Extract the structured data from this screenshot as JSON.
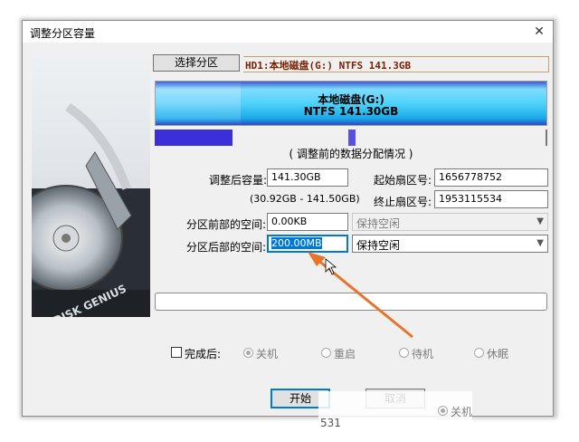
{
  "window": {
    "title": "调整分区容量",
    "close": "✕"
  },
  "sidebar_image": {
    "brand": "DISK GENIUS"
  },
  "select_partition": {
    "label": "选择分区"
  },
  "disk_info": "HD1:本地磁盘(G:) NTFS 141.3GB",
  "partition_bar": {
    "line1": "本地磁盘(G:)",
    "line2": "NTFS 141.30GB"
  },
  "caption": "( 调整前的数据分配情况 )",
  "form": {
    "resized_capacity": {
      "label": "调整后容量:",
      "value": "141.30GB"
    },
    "range": "(30.92GB - 141.50GB)",
    "start_sector": {
      "label": "起始扇区号:",
      "value": "1656778752"
    },
    "end_sector": {
      "label": "终止扇区号:",
      "value": "1953115534"
    },
    "space_before": {
      "label": "分区前部的空间:",
      "value": "0.00KB",
      "option": "保持空闲"
    },
    "space_after": {
      "label": "分区后部的空间:",
      "value": "200.00MB",
      "option": "保持空闲"
    }
  },
  "after_complete": {
    "label": "完成后:",
    "options": [
      "关机",
      "重启",
      "待机",
      "休眠"
    ],
    "selected": "关机"
  },
  "buttons": {
    "start": "开始",
    "cancel": "取消"
  },
  "ghost": {
    "text": "531",
    "option": "关机"
  },
  "colors": {
    "accent": "#0078d7",
    "arrow": "#e8742a",
    "bar": "#1aa9e8"
  }
}
